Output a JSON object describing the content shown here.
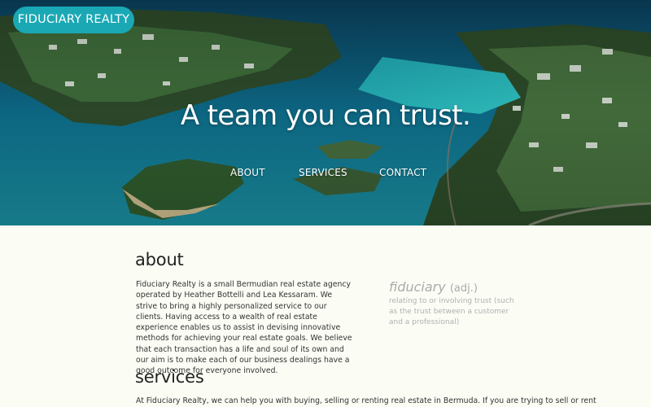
{
  "header": {
    "brand": "FIDUCIARY REALTY",
    "tagline": "A team you can trust.",
    "nav": [
      {
        "label": "ABOUT"
      },
      {
        "label": "SERVICES"
      },
      {
        "label": "CONTACT"
      }
    ]
  },
  "about": {
    "heading": "about",
    "body": "Fiduciary Realty is a small Bermudian real estate agency operated by Heather Bottelli and Lea Kessaram. We strive to bring a highly personalized service to our clients. Having access to a wealth of real estate experience enables us to assist in devising innovative methods for achieving your real estate goals. We believe that each transaction has a life and soul of its own and our aim is to make each of our business dealings have a good outcome for everyone involved.",
    "definition": {
      "term": "fiduciary",
      "part_of_speech": "(adj.)",
      "meaning": "relating to or involving trust (such as the trust between a customer and a professional)"
    }
  },
  "services": {
    "heading": "services",
    "body": "At Fiduciary Realty, we can help you with buying, selling or renting real estate in Bermuda. If you are trying to sell or rent"
  },
  "colors": {
    "brand_pill": "#1aa8b5",
    "page_background": "#fbfdf5",
    "hero_water": "#0e5a7a"
  }
}
